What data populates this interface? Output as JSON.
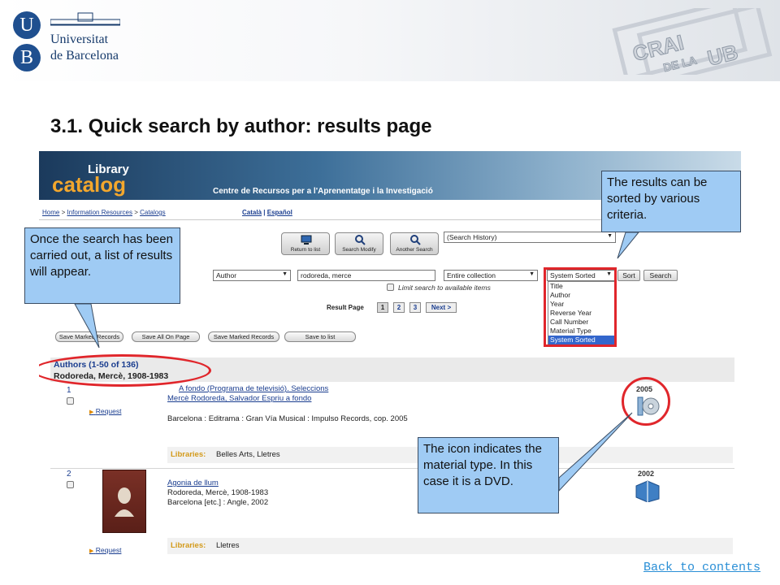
{
  "header": {
    "logo_u": "U",
    "logo_b": "B",
    "university_line1": "Universitat",
    "university_line2": "de Barcelona",
    "crai_logo_text": "CRAI DE LA UB"
  },
  "slide_title": "3.1. Quick search by author: results page",
  "catalog": {
    "banner_library": "Library",
    "banner_catalog": "catalog",
    "centre_name": "Centre de Recursos per a l'Aprenentatge i la Investigació",
    "breadcrumb": [
      "Home",
      "Information Resources",
      "Catalogs"
    ],
    "breadcrumb_sep": ">",
    "languages": [
      "Català",
      "Español"
    ],
    "lang_sep": "|",
    "tool_buttons": [
      "Return to list",
      "Search Modify",
      "Another Search"
    ],
    "history_select": "(Search History)",
    "search_type": "Author",
    "search_value": "rodoreda, merce",
    "collection": "Entire collection",
    "sort_select": "System Sorted",
    "sort_button": "Sort",
    "search_button": "Search",
    "limit_label": "Limit search to available items",
    "sort_options": [
      "Title",
      "Author",
      "Year",
      "Reverse Year",
      "Call Number",
      "Material Type",
      "System Sorted"
    ],
    "sort_selected_index": 6,
    "result_page_label": "Result Page",
    "pages": [
      "1",
      "2",
      "3"
    ],
    "next_label": "Next >",
    "action_buttons": [
      "Save Marked Records",
      "Save All On Page",
      "Save Marked Records",
      "Save to list"
    ],
    "authors_count": "Authors (1-50 of 136)",
    "author_heading": "Rodoreda, Mercè, 1908-1983",
    "records": [
      {
        "num": "1",
        "request": "Request",
        "title": "A fondo (Programa de televisió). Seleccions",
        "subtitle": "Mercè Rodoreda, Salvador Espriu a fondo",
        "line1": "",
        "line2": "Barcelona : Editrama : Gran Vía Musical : Impulso Records, cop. 2005",
        "libraries_label": "Libraries:",
        "libraries": "Belles Arts, Lletres",
        "year": "2005",
        "material_icon": "dvd-icon"
      },
      {
        "num": "2",
        "request": "Request",
        "title": "Agonia de llum",
        "subtitle": "",
        "line1": "Rodoreda, Mercè, 1908-1983",
        "line2": "Barcelona [etc.] : Angle, 2002",
        "libraries_label": "Libraries:",
        "libraries": "Lletres",
        "year": "2002",
        "material_icon": "book-icon"
      }
    ]
  },
  "callouts": {
    "sort": "The results can be sorted by various criteria.",
    "list": "Once the search has been carried out, a list of results will appear.",
    "icon": "The icon indicates the material type. In this case it is a DVD."
  },
  "back_link": "Back to contents",
  "colors": {
    "highlight_red": "#e0262b",
    "callout_blue": "#9fcbf4",
    "link_blue": "#1a3d8f",
    "selected_option": "#3366cc"
  }
}
